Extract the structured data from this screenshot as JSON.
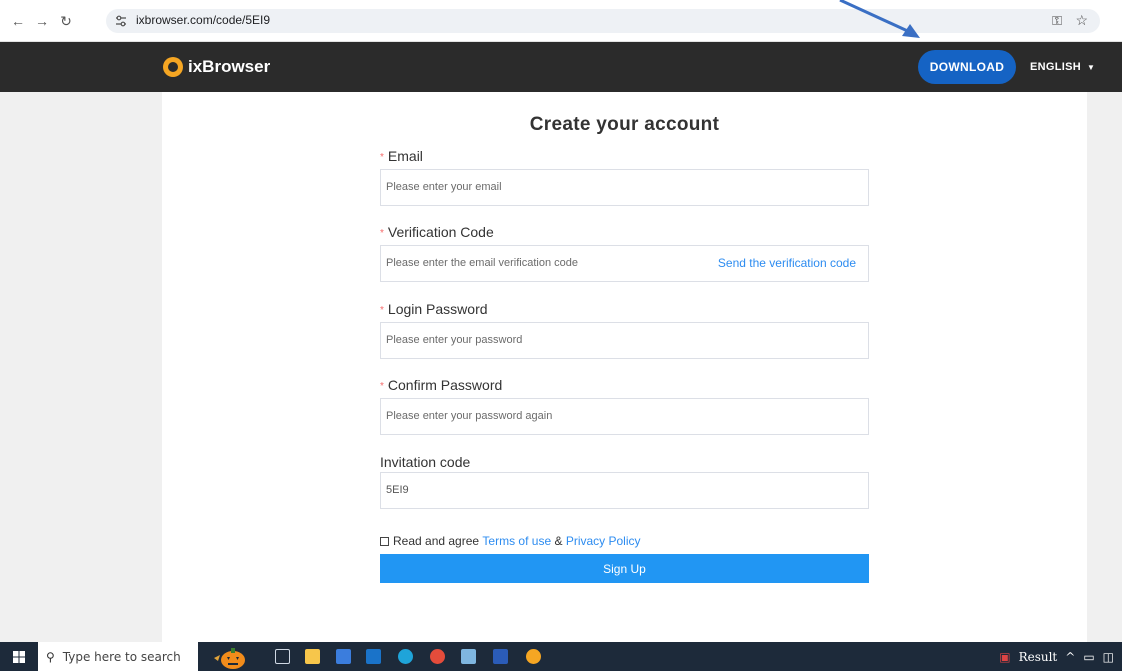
{
  "browser": {
    "url": "ixbrowser.com/code/5EI9"
  },
  "header": {
    "brand": "ixBrowser",
    "download_label": "DOWNLOAD",
    "language_label": "ENGLISH"
  },
  "form": {
    "title": "Create your account",
    "email": {
      "label": "Email",
      "placeholder": "Please enter your email"
    },
    "verification": {
      "label": "Verification Code",
      "placeholder": "Please enter the email verification code",
      "send_label": "Send the verification code"
    },
    "password": {
      "label": "Login Password",
      "placeholder": "Please enter your password"
    },
    "confirm": {
      "label": "Confirm Password",
      "placeholder": "Please enter your password again"
    },
    "invitation": {
      "label": "Invitation code",
      "value": "5EI9"
    },
    "agree": {
      "prefix": "Read and agree",
      "terms": "Terms of use",
      "amp": "&",
      "privacy": "Privacy Policy"
    },
    "signup_label": "Sign Up"
  },
  "taskbar": {
    "search_placeholder": "Type here to search",
    "tray_label": "Result"
  },
  "colors": {
    "header_bg": "#2b2b2b",
    "download_bg": "#1563c4",
    "link": "#2d8cf0",
    "signup_bg": "#2196f3",
    "required": "#f56c6c"
  }
}
